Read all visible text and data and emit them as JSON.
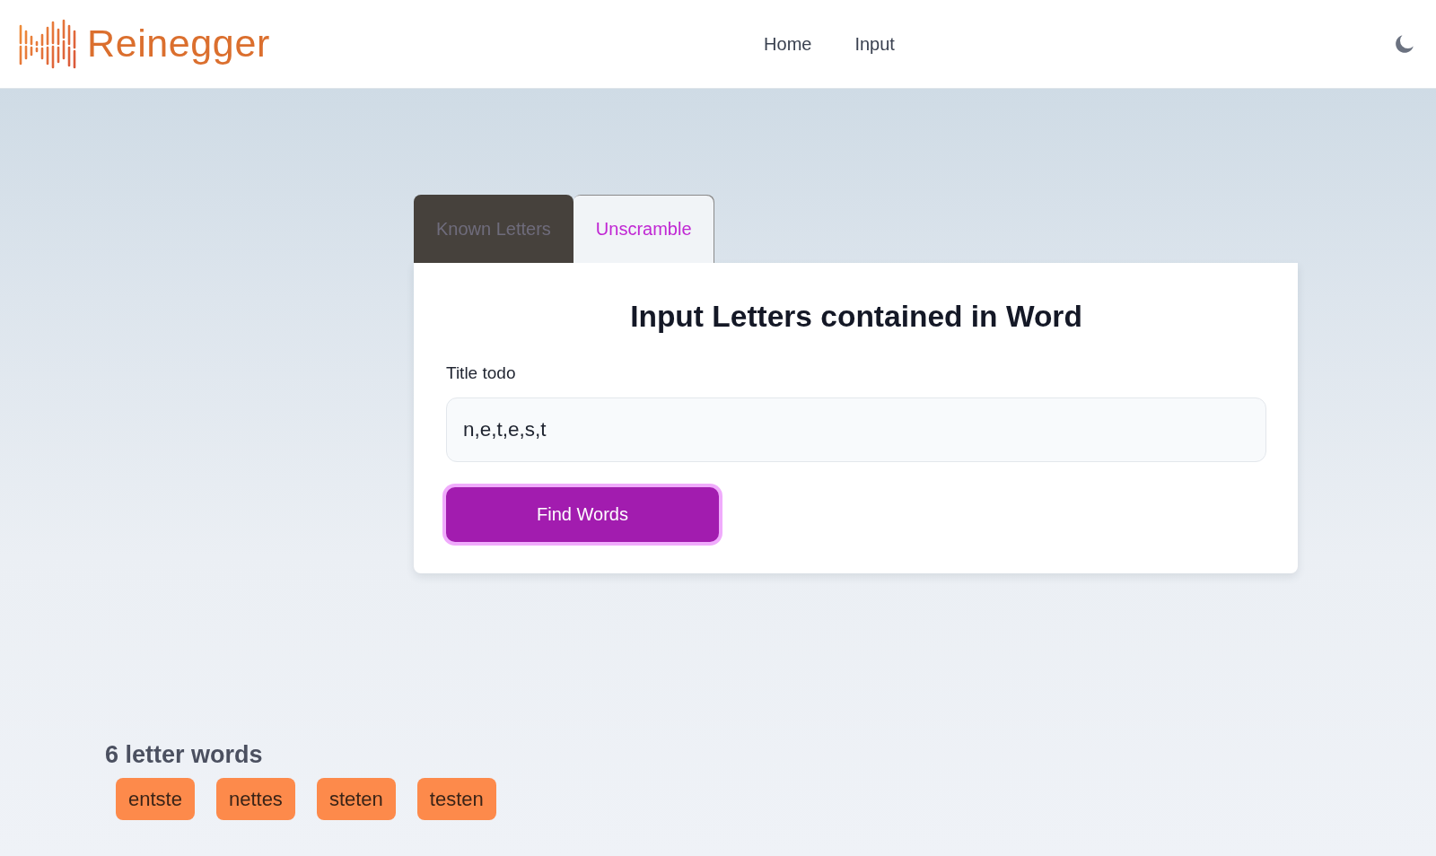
{
  "header": {
    "logo": "Reinegger",
    "nav": [
      {
        "label": "Home"
      },
      {
        "label": "Input"
      }
    ]
  },
  "tabs": [
    {
      "label": "Known Letters",
      "selected": false
    },
    {
      "label": "Unscramble",
      "selected": true
    }
  ],
  "form": {
    "title": "Input Letters contained in Word",
    "label": "Title todo",
    "value": "n,e,t,e,s,t",
    "button": "Find Words"
  },
  "results": [
    {
      "heading": "6 letter words",
      "words": [
        "entste",
        "nettes",
        "steten",
        "testen"
      ]
    }
  ]
}
